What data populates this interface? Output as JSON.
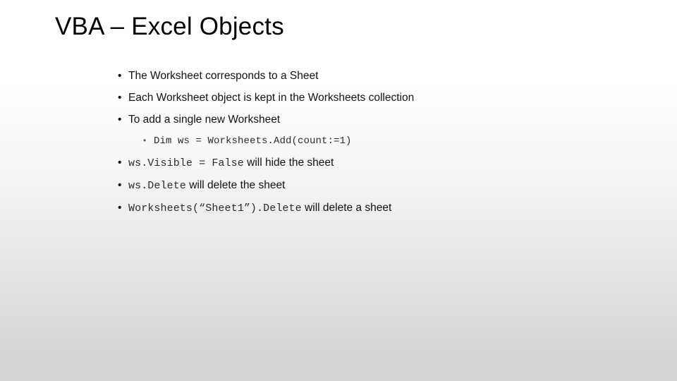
{
  "slide": {
    "title": "VBA – Excel Objects",
    "background": {
      "top_color": "#ffffff",
      "bottom_color": "#d3d3d4"
    },
    "text_color": "#121212",
    "bullet_glyph": "•",
    "sub_bullet_glyph": "•",
    "bullets": [
      {
        "level": 1,
        "runs": [
          {
            "style": "prose",
            "text": "The Worksheet corresponds to a Sheet"
          }
        ]
      },
      {
        "level": 1,
        "runs": [
          {
            "style": "prose",
            "text": "Each Worksheet object is kept in the Worksheets collection"
          }
        ]
      },
      {
        "level": 1,
        "runs": [
          {
            "style": "prose",
            "text": "To add a single new Worksheet"
          }
        ]
      },
      {
        "level": 2,
        "runs": [
          {
            "style": "mono",
            "text": "Dim ws = Worksheets.Add(count:=1)"
          }
        ]
      },
      {
        "level": 1,
        "runs": [
          {
            "style": "mono",
            "text": "ws.Visible = False"
          },
          {
            "style": "prose",
            "text": " will hide the sheet"
          }
        ]
      },
      {
        "level": 1,
        "runs": [
          {
            "style": "mono",
            "text": "ws.Delete"
          },
          {
            "style": "prose",
            "text": " will delete the sheet"
          }
        ]
      },
      {
        "level": 1,
        "runs": [
          {
            "style": "mono",
            "text": "Worksheets(“Sheet1”).Delete"
          },
          {
            "style": "prose",
            "text": " will delete a sheet"
          }
        ]
      }
    ]
  }
}
